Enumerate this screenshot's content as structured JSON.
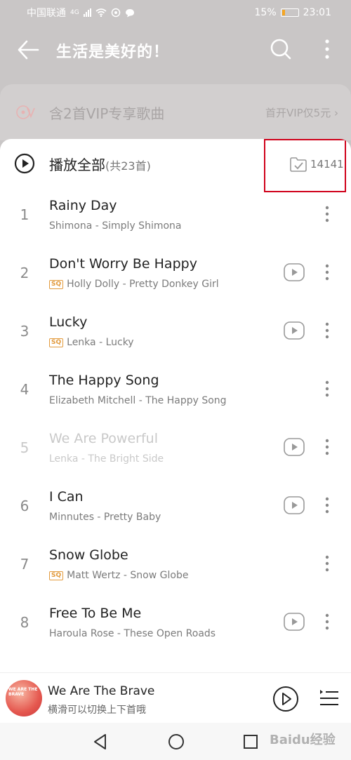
{
  "status_bar": {
    "carrier": "中国联通",
    "network": "4G",
    "battery": "15%",
    "time": "23:01"
  },
  "header": {
    "title": "生活是美好的！"
  },
  "vip_banner": {
    "text": "含2首VIP专享歌曲",
    "link": "首开VIP仅5元 ›"
  },
  "play_all": {
    "label": "播放全部",
    "count": "(共23首)",
    "collect_count": "14141"
  },
  "songs": [
    {
      "index": "1",
      "title": "Rainy Day",
      "artist": "Shimona - Simply Shimona"
    },
    {
      "index": "2",
      "title": "Don't Worry Be Happy",
      "artist": "Holly Dolly - Pretty Donkey Girl"
    },
    {
      "index": "3",
      "title": "Lucky",
      "artist": "Lenka - Lucky"
    },
    {
      "index": "4",
      "title": "The Happy Song",
      "artist": "Elizabeth Mitchell - The Happy Song"
    },
    {
      "index": "5",
      "title": "We Are Powerful",
      "artist": "Lenka - The Bright Side"
    },
    {
      "index": "6",
      "title": "I Can",
      "artist": "Minnutes - Pretty Baby"
    },
    {
      "index": "7",
      "title": "Snow Globe",
      "artist": "Matt Wertz - Snow Globe"
    },
    {
      "index": "8",
      "title": "Free To Be Me",
      "artist": "Haroula Rose - These Open Roads"
    }
  ],
  "badge": "SQ",
  "now_playing": {
    "title": "We Are The Brave",
    "subtitle": "横滑可以切换上下首哦",
    "art_text": "WE ARE THE BRAVE"
  },
  "watermark": "Baidu经验",
  "colors": {
    "highlight_box": "#d0021b",
    "sq_badge": "#e29a3c",
    "battery": "#f5a623"
  }
}
